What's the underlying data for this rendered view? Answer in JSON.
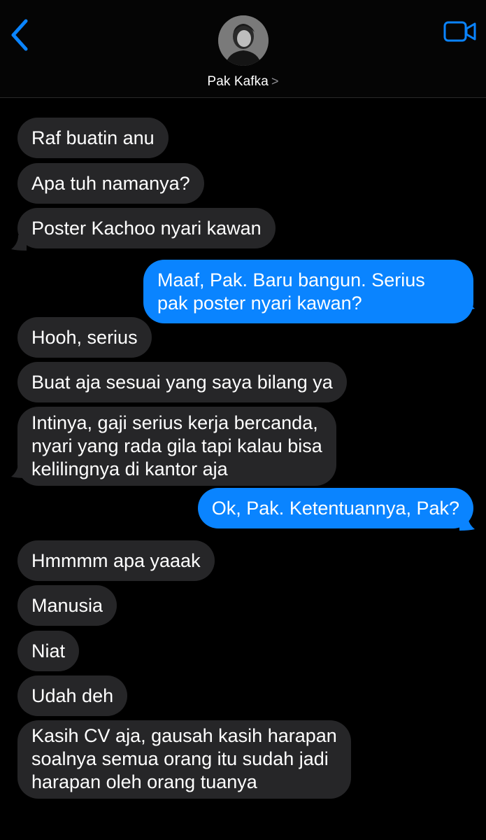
{
  "header": {
    "contact_name": "Pak Kafka",
    "chevron": ">"
  },
  "icons": {
    "back": "chevron-left-icon",
    "video": "video-camera-icon",
    "accent": "#0a84ff",
    "incoming_bubble": "#262628"
  },
  "messages": [
    {
      "dir": "in",
      "text": "Raf buatin anu"
    },
    {
      "dir": "in",
      "text": "Apa tuh namanya?"
    },
    {
      "dir": "in",
      "text": "Poster Kachoo nyari kawan"
    },
    {
      "dir": "out",
      "lines": [
        "Maaf, Pak. Baru bangun. Serius",
        "pak poster nyari kawan?"
      ]
    },
    {
      "dir": "in",
      "text": "Hooh, serius"
    },
    {
      "dir": "in",
      "text": "Buat aja sesuai yang saya bilang ya"
    },
    {
      "dir": "in",
      "lines": [
        "Intinya, gaji serius kerja bercanda,",
        "nyari yang rada gila tapi kalau bisa",
        "kelilingnya di kantor aja"
      ]
    },
    {
      "dir": "out",
      "text": "Ok, Pak. Ketentuannya, Pak?"
    },
    {
      "dir": "in",
      "text": "Hmmmm apa yaaak"
    },
    {
      "dir": "in",
      "text": "Manusia"
    },
    {
      "dir": "in",
      "text": "Niat"
    },
    {
      "dir": "in",
      "text": "Udah deh"
    },
    {
      "dir": "in",
      "lines": [
        "Kasih CV aja, gausah kasih harapan",
        "soalnya semua orang itu sudah jadi",
        "harapan oleh orang tuanya"
      ]
    }
  ]
}
